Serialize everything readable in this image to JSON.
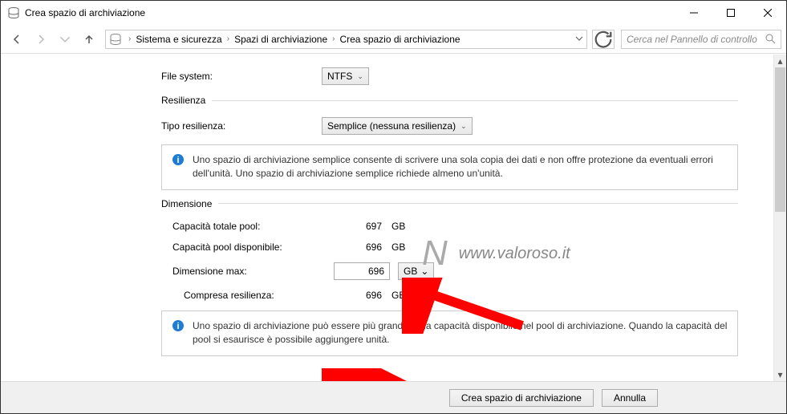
{
  "titlebar": {
    "title": "Crea spazio di archiviazione"
  },
  "breadcrumbs": {
    "items": [
      "Sistema e sicurezza",
      "Spazi di archiviazione",
      "Crea spazio di archiviazione"
    ]
  },
  "search": {
    "placeholder": "Cerca nel Pannello di controllo"
  },
  "filesystem": {
    "label": "File system:",
    "value": "NTFS"
  },
  "resilience": {
    "group_label": "Resilienza",
    "type_label": "Tipo resilienza:",
    "type_value": "Semplice (nessuna resilienza)",
    "info": "Uno spazio di archiviazione semplice consente di scrivere una sola copia dei dati e non offre protezione da eventuali errori dell'unità. Uno spazio di archiviazione semplice richiede almeno un'unità."
  },
  "dimension": {
    "group_label": "Dimensione",
    "total_label": "Capacità totale pool:",
    "total_value": "697",
    "total_unit": "GB",
    "avail_label": "Capacità pool disponibile:",
    "avail_value": "696",
    "avail_unit": "GB",
    "max_label": "Dimensione max:",
    "max_value": "696",
    "max_unit": "GB",
    "resil_label": "Compresa resilienza:",
    "resil_value": "696",
    "resil_unit": "GB",
    "info": "Uno spazio di archiviazione può essere più grande della capacità disponibile nel pool di archiviazione. Quando la capacità del pool si esaurisce è possibile aggiungere unità."
  },
  "footer": {
    "create": "Crea spazio di archiviazione",
    "cancel": "Annulla"
  },
  "watermark": {
    "text": "www.valoroso.it"
  }
}
